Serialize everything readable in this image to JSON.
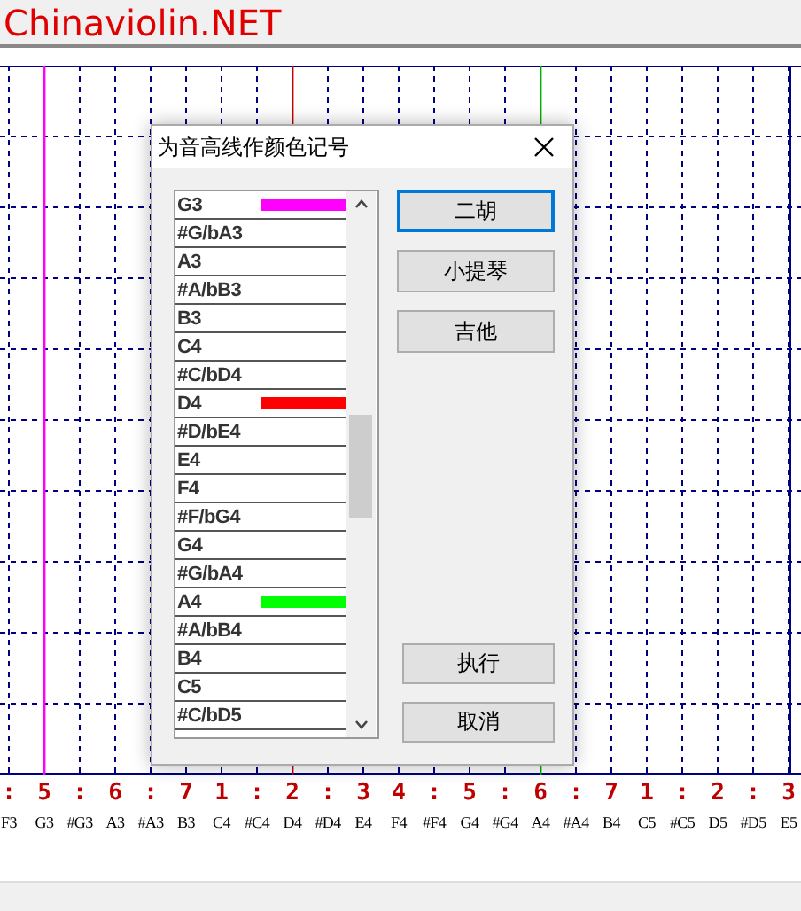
{
  "header": {
    "logo": "Chinaviolin.NET"
  },
  "columns": [
    {
      "digit": ":",
      "note": "F3"
    },
    {
      "digit": "5",
      "note": "G3",
      "color": "#ff00ff"
    },
    {
      "digit": ":",
      "note": "#G3"
    },
    {
      "digit": "6",
      "note": "A3"
    },
    {
      "digit": ":",
      "note": "#A3"
    },
    {
      "digit": "7",
      "note": "B3"
    },
    {
      "digit": "1",
      "note": "C4"
    },
    {
      "digit": ":",
      "note": "#C4"
    },
    {
      "digit": "2",
      "note": "D4",
      "color": "#c00000"
    },
    {
      "digit": ":",
      "note": "#D4"
    },
    {
      "digit": "3",
      "note": "E4"
    },
    {
      "digit": "4",
      "note": "F4"
    },
    {
      "digit": ":",
      "note": "#F4"
    },
    {
      "digit": "5",
      "note": "G4"
    },
    {
      "digit": ":",
      "note": "#G4"
    },
    {
      "digit": "6",
      "note": "A4",
      "color": "#00b000"
    },
    {
      "digit": ":",
      "note": "#A4"
    },
    {
      "digit": "7",
      "note": "B4"
    },
    {
      "digit": "1",
      "note": "C5"
    },
    {
      "digit": ":",
      "note": "#C5"
    },
    {
      "digit": "2",
      "note": "D5"
    },
    {
      "digit": ":",
      "note": "#D5"
    },
    {
      "digit": "3",
      "note": "E5"
    }
  ],
  "dialog": {
    "title": "为音高线作颜色记号",
    "pitches": [
      {
        "label": "G3",
        "color": "#ff00ff"
      },
      {
        "label": "#G/bA3"
      },
      {
        "label": "A3"
      },
      {
        "label": "#A/bB3"
      },
      {
        "label": "B3"
      },
      {
        "label": "C4"
      },
      {
        "label": "#C/bD4"
      },
      {
        "label": "D4",
        "color": "#ff0000"
      },
      {
        "label": "#D/bE4"
      },
      {
        "label": "E4"
      },
      {
        "label": "F4"
      },
      {
        "label": "#F/bG4"
      },
      {
        "label": "G4"
      },
      {
        "label": "#G/bA4"
      },
      {
        "label": "A4",
        "color": "#00ff00"
      },
      {
        "label": "#A/bB4"
      },
      {
        "label": "B4"
      },
      {
        "label": "C5"
      },
      {
        "label": "#C/bD5"
      }
    ],
    "presets": [
      {
        "label": "二胡",
        "selected": true
      },
      {
        "label": "小提琴",
        "selected": false
      },
      {
        "label": "吉他",
        "selected": false
      }
    ],
    "actions": [
      "执行",
      "取消"
    ]
  }
}
